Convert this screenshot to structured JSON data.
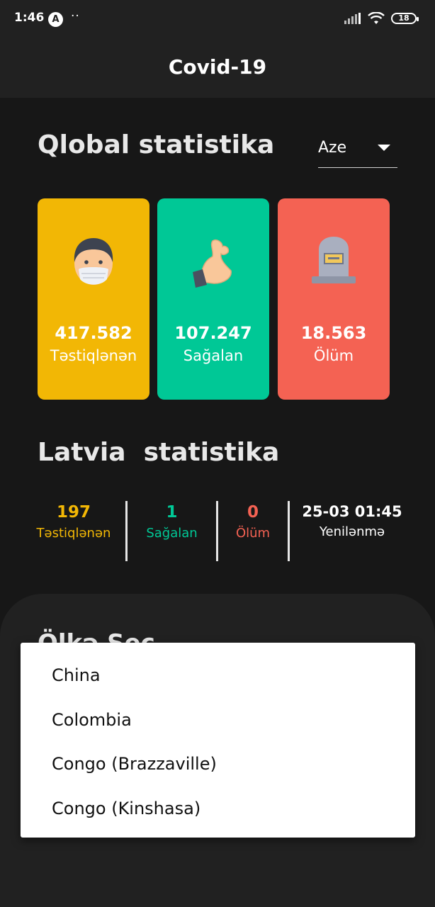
{
  "status_bar": {
    "time": "1:46",
    "notification_icon": "A",
    "extra": "··",
    "battery": "18"
  },
  "app_bar": {
    "title": "Covid-19"
  },
  "global": {
    "title": "Qlobal statistika",
    "language": {
      "selected": "Aze"
    },
    "cards": [
      {
        "value": "417.582",
        "label": "Təstiqlənən",
        "color": "#F2B705",
        "icon": "mask-face-icon"
      },
      {
        "value": "107.247",
        "label": "Sağalan",
        "color": "#00C896",
        "icon": "flexed-biceps-icon"
      },
      {
        "value": "18.563",
        "label": "Ölüm",
        "color": "#F46253",
        "icon": "tombstone-icon"
      }
    ]
  },
  "country": {
    "name": "Latvia",
    "title_suffix": "statistika",
    "stats": [
      {
        "value": "197",
        "label": "Təstiqlənən",
        "color": "#F2B705"
      },
      {
        "value": "1",
        "label": "Sağalan",
        "color": "#00C896"
      },
      {
        "value": "0",
        "label": "Ölüm",
        "color": "#F46253"
      },
      {
        "value": "25-03 01:45",
        "label": "Yenilənmə",
        "color": "#ffffff"
      }
    ]
  },
  "sheet": {
    "title": "Ölkə Seç"
  },
  "dropdown": {
    "options": [
      "China",
      "Colombia",
      "Congo (Brazzaville)",
      "Congo (Kinshasa)"
    ]
  }
}
